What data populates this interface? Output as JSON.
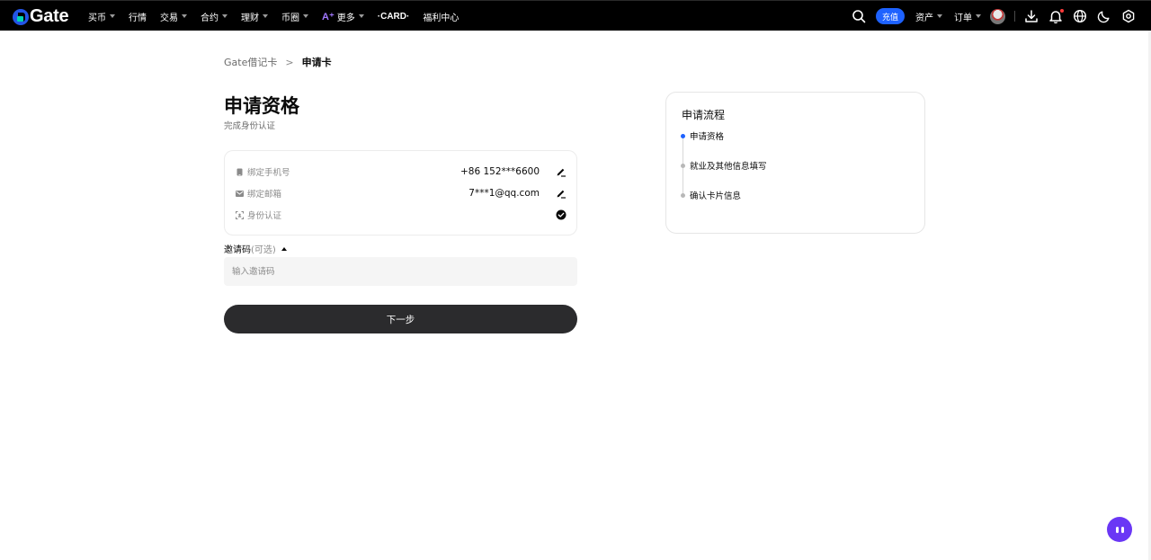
{
  "brand": {
    "logo_text": "Gate",
    "logo_colors": [
      "#2354e6",
      "#00d6b4"
    ]
  },
  "nav": {
    "items": [
      {
        "label": "买币",
        "dropdown": true
      },
      {
        "label": "行情",
        "dropdown": false
      },
      {
        "label": "交易",
        "dropdown": true
      },
      {
        "label": "合约",
        "dropdown": true
      },
      {
        "label": "理财",
        "dropdown": true
      },
      {
        "label": "币圈",
        "dropdown": true
      },
      {
        "label": "更多",
        "dropdown": true,
        "prefix_icon": "ai-icon"
      },
      {
        "label": "CARD",
        "dropdown": false
      },
      {
        "label": "福利中心",
        "dropdown": false
      }
    ]
  },
  "toolbar": {
    "deposit_label": "充值",
    "assets_label": "资产",
    "orders_label": "订单",
    "icons": [
      "search-icon",
      "avatar",
      "download-icon",
      "bell-icon",
      "globe-icon",
      "moon-icon",
      "settings-icon"
    ],
    "accent_color": "#1e62ff",
    "notification_dot_color": "#ff3a3a"
  },
  "breadcrumb": {
    "parent": "Gate借记卡",
    "separator": ">",
    "current": "申请卡"
  },
  "page": {
    "title": "申请资格",
    "subtitle": "完成身份认证"
  },
  "verification": {
    "rows": [
      {
        "label": "绑定手机号",
        "value": "+86 152***6600",
        "icon": "phone-icon",
        "action_icon": "edit-icon"
      },
      {
        "label": "绑定邮箱",
        "value": "7***1@qq.com",
        "icon": "mail-icon",
        "action_icon": "edit-icon"
      },
      {
        "label": "身份认证",
        "value": "",
        "icon": "id-scan-icon",
        "action_icon": "verified-check-icon"
      }
    ]
  },
  "invite": {
    "label": "邀请码",
    "optional": "(可选)",
    "placeholder": "输入邀请码",
    "value": ""
  },
  "next_button": {
    "label": "下一步",
    "color": "#2b2b2d"
  },
  "process": {
    "title": "申请流程",
    "steps": [
      {
        "label": "申请资格",
        "active": true
      },
      {
        "label": "就业及其他信息填写",
        "active": false
      },
      {
        "label": "确认卡片信息",
        "active": false
      }
    ]
  },
  "assistant": {
    "icon": "assistant-bot-icon",
    "color": "#6a37f5"
  }
}
